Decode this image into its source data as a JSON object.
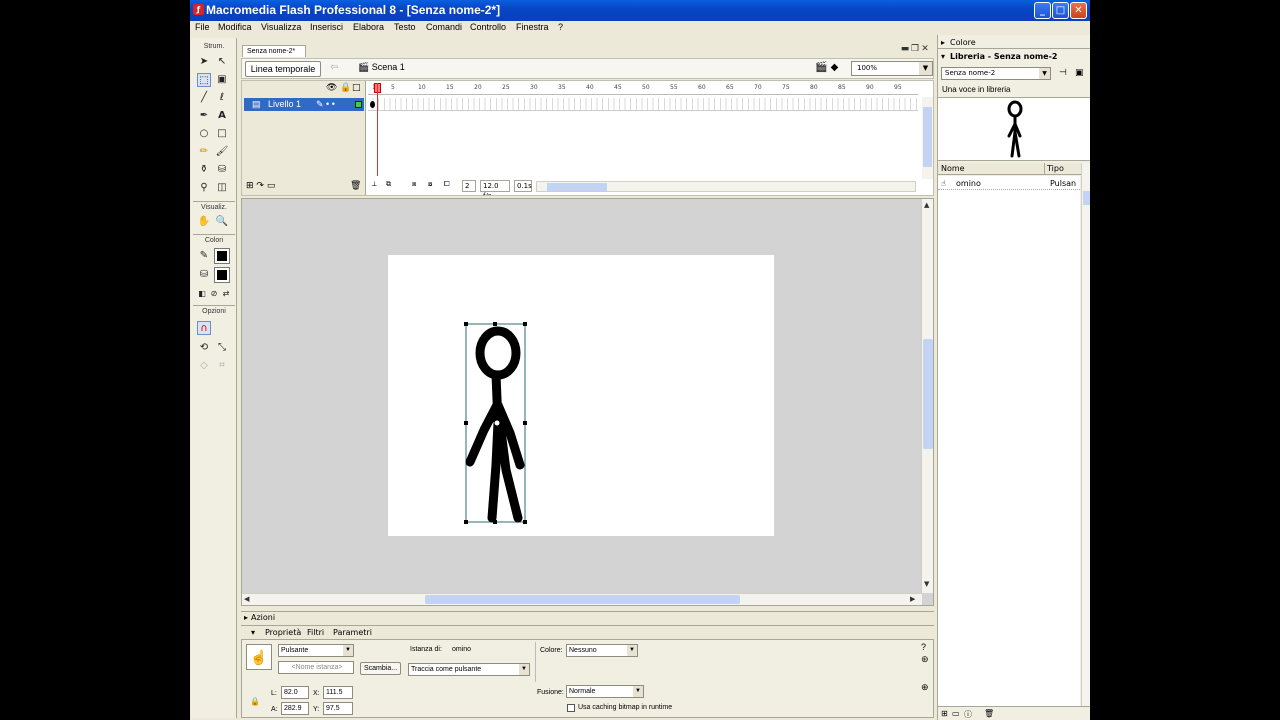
{
  "window": {
    "title": "Macromedia Flash Professional 8 - [Senza nome-2*]",
    "controls": {
      "minimize": "_",
      "maximize": "□",
      "close": "✕"
    }
  },
  "menu": [
    "File",
    "Modifica",
    "Visualizza",
    "Inserisci",
    "Elabora",
    "Testo",
    "Comandi",
    "Controllo",
    "Finestra",
    "?"
  ],
  "tools": {
    "section_tools": "Strum.",
    "section_view": "Visualiz.",
    "section_colors": "Colori",
    "section_options": "Opzioni"
  },
  "document": {
    "tab": "Senza nome-2*",
    "timeline_button": "Linea temporale",
    "scene": "Scena 1",
    "zoom": "100%"
  },
  "timeline": {
    "layer_name": "Livello 1",
    "ruler": [
      "1",
      "5",
      "10",
      "15",
      "20",
      "25",
      "30",
      "35",
      "40",
      "45",
      "50",
      "55",
      "60",
      "65",
      "70",
      "75",
      "80",
      "85",
      "90",
      "95"
    ],
    "current_frame": "2",
    "frame_rate": "12.0 f/s",
    "elapsed": "0.1s"
  },
  "actions": {
    "label": "Azioni"
  },
  "properties": {
    "tabs": [
      "Proprietà",
      "Filtri",
      "Parametri"
    ],
    "behavior": "Pulsante",
    "instance_name_placeholder": "<Nome istanza>",
    "instance_of_label": "Istanza di:",
    "instance_of_value": "omino",
    "swap_button": "Scambia...",
    "tracking": "Traccia come pulsante",
    "color_label": "Colore:",
    "color_value": "Nessuno",
    "blend_label": "Fusione:",
    "blend_value": "Normale",
    "cache_label": "Usa caching bitmap in runtime",
    "w_label": "L:",
    "w_value": "82.0",
    "h_label": "A:",
    "h_value": "282.9",
    "x_label": "X:",
    "x_value": "111.5",
    "y_label": "Y:",
    "y_value": "97.5"
  },
  "panels": {
    "color_title": "Colore",
    "library_title": "Libreria - Senza nome-2",
    "library_dropdown": "Senza nome-2",
    "library_count": "Una voce in libreria",
    "col_name": "Nome",
    "col_type": "Tipo",
    "items": [
      {
        "name": "omino",
        "type": "Pulsan"
      }
    ]
  }
}
